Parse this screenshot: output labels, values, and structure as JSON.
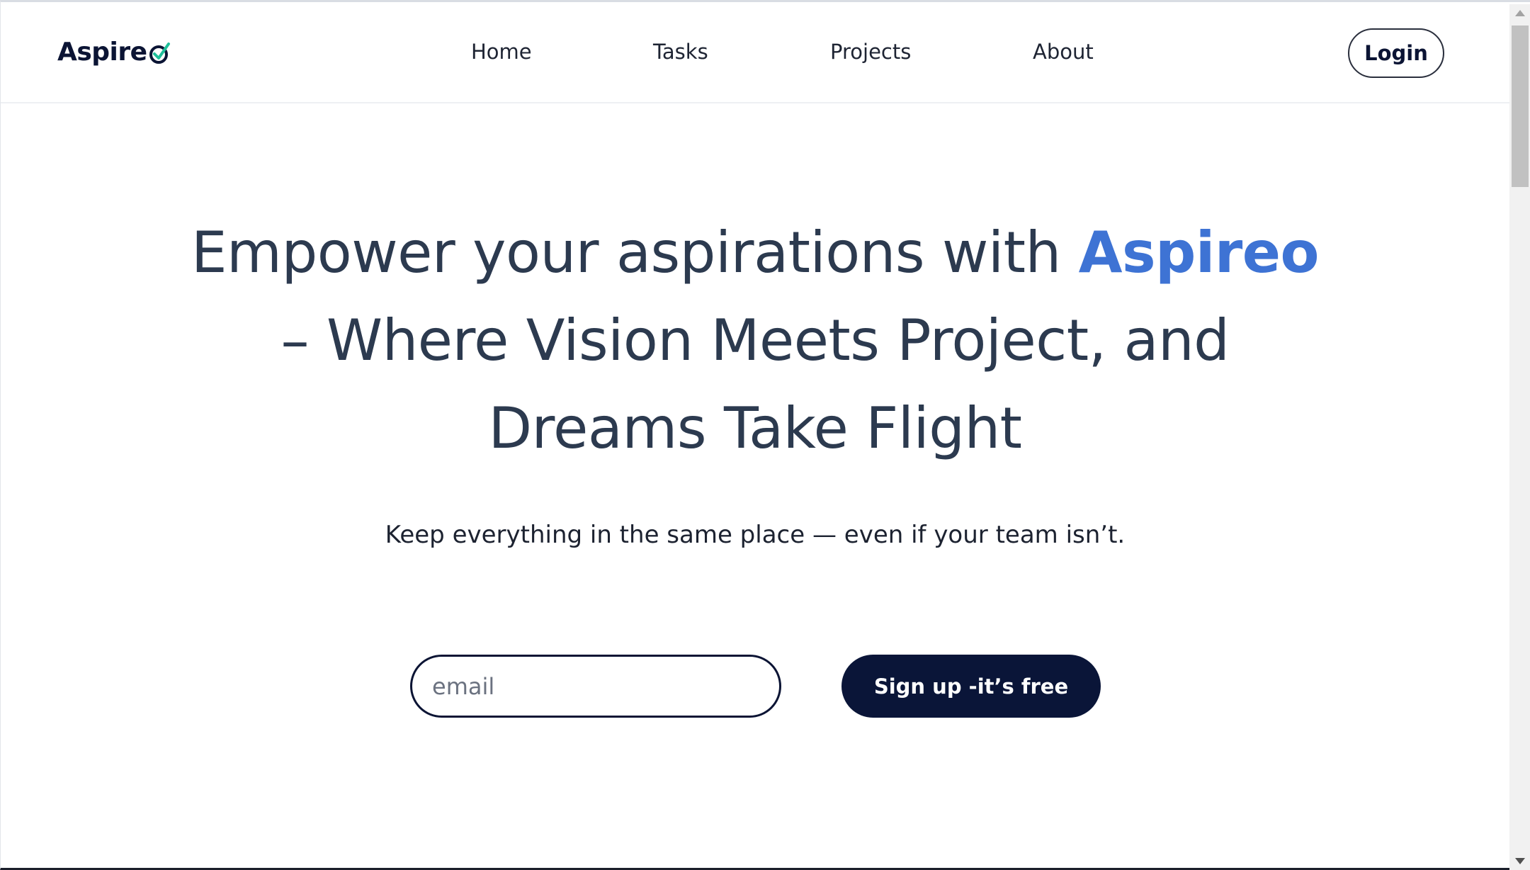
{
  "brand": {
    "name": "Aspire",
    "accent_color": "#3e73d4",
    "logo_check_color": "#1fbf9a"
  },
  "nav": {
    "items": [
      {
        "label": "Home"
      },
      {
        "label": "Tasks"
      },
      {
        "label": "Projects"
      },
      {
        "label": "About"
      }
    ],
    "login_label": "Login"
  },
  "hero": {
    "title_prefix": "Empower your aspirations with ",
    "title_brand": "Aspireo",
    "title_suffix": " – Where Vision Meets Project, and Dreams Take Flight",
    "subtitle": "Keep everything in the same place — even if your team isn’t."
  },
  "signup": {
    "email_placeholder": "email",
    "email_value": "",
    "button_label": "Sign up -it’s free"
  },
  "colors": {
    "text_primary": "#2c3a4f",
    "button_dark": "#0a1538"
  }
}
